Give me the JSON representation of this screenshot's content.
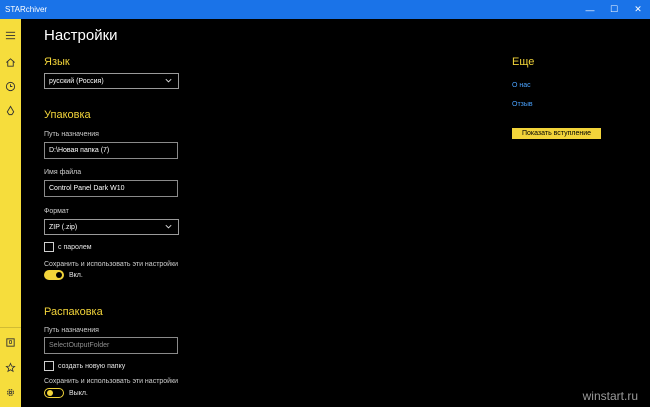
{
  "window": {
    "title": "STARchiver",
    "controls": {
      "minimize": "—",
      "maximize": "☐",
      "close": "✕"
    }
  },
  "sidebar": {
    "items": [
      {
        "name": "menu",
        "icon": "hamburger-icon"
      },
      {
        "name": "home",
        "icon": "home-icon"
      },
      {
        "name": "history",
        "icon": "clock-icon"
      },
      {
        "name": "recycle",
        "icon": "recycle-icon"
      },
      {
        "name": "archive",
        "icon": "archive-icon"
      },
      {
        "name": "favorites",
        "icon": "star-icon"
      },
      {
        "name": "settings",
        "icon": "gear-icon"
      }
    ]
  },
  "page": {
    "title": "Настройки"
  },
  "language": {
    "title": "Язык",
    "selected": "русский (Россия)"
  },
  "packing": {
    "title": "Упаковка",
    "dest_label": "Путь назначения",
    "dest_value": "D:\\Новая папка (7)",
    "filename_label": "Имя файла",
    "filename_value": "Control Panel Dark W10",
    "format_label": "Формат",
    "format_value": "ZIP (.zip)",
    "password_label": "с паролем",
    "save_label": "Сохранить и использовать эти настройки",
    "toggle_label": "Вкл."
  },
  "unpacking": {
    "title": "Распаковка",
    "dest_label": "Путь назначения",
    "dest_placeholder": "SelectOutputFolder",
    "new_folder_label": "создать новую папку",
    "save_label": "Сохранить и использовать эти настройки",
    "toggle_label": "Выкл."
  },
  "more": {
    "title": "Еще",
    "about": "О нас",
    "feedback": "Отзыв",
    "intro_button": "Показать вступление"
  },
  "watermark": "winstart.ru",
  "colors": {
    "accent_yellow": "#f2d43a",
    "sidebar_yellow": "#f6dd3c",
    "titlebar_blue": "#1a73e8",
    "link_blue": "#4aa3ff"
  }
}
